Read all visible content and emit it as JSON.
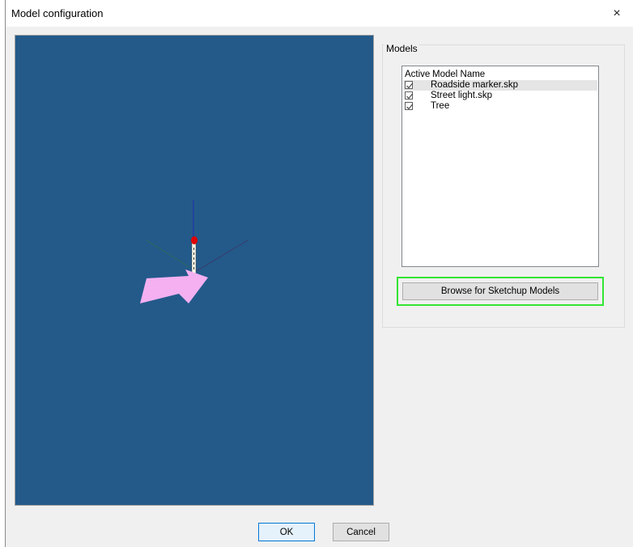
{
  "window": {
    "title": "Model configuration",
    "close_label": "×"
  },
  "viewport": {
    "background_color": "#235a8a",
    "arrow_color": "#f4b0f1",
    "marker_color": "#e00000"
  },
  "models_panel": {
    "group_label": "Models",
    "columns": {
      "active": "Active",
      "name": "Model Name"
    },
    "items": [
      {
        "active": true,
        "name": "Roadside marker.skp",
        "selected": true
      },
      {
        "active": true,
        "name": "Street light.skp",
        "selected": false
      },
      {
        "active": true,
        "name": "Tree",
        "selected": false
      }
    ],
    "browse_label": "Browse for Sketchup Models",
    "highlight_color": "#33e533"
  },
  "footer": {
    "ok_label": "OK",
    "cancel_label": "Cancel"
  }
}
